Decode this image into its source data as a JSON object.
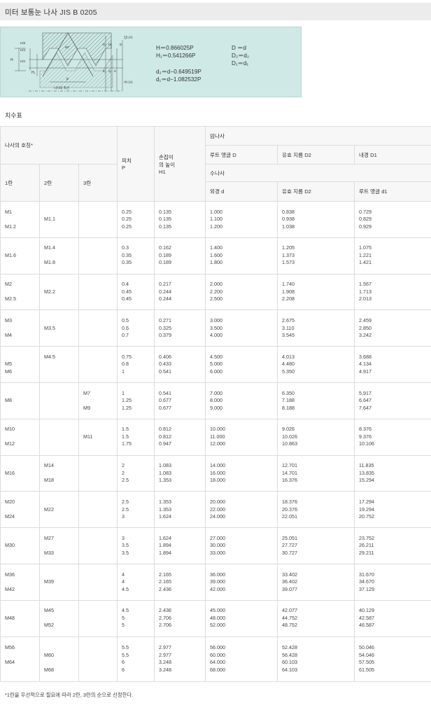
{
  "title": "미터 보통눈 나사 JIS B 0205",
  "diagram": {
    "formulas_left": [
      "H＝0.866025P",
      "H₁＝0.541266P",
      "d₂＝d−0.649519P",
      "d₁＝d−1.082532P"
    ],
    "formulas_right": [
      "D ＝d",
      "D₂＝d₂",
      "D₁＝d₁"
    ],
    "labels": {
      "axis": "나사의 축선",
      "p": "P",
      "nut": "암나사",
      "bolt": "수나사",
      "d": "d",
      "d2": "d₂",
      "d1": "d₁",
      "D": "D",
      "D2": "D₂",
      "D1": "D₁",
      "h1": "H₁",
      "h": "H",
      "h_small": "H/8",
      "h_quarter": "H/4",
      "h_half": "H/2",
      "angle": "60°"
    }
  },
  "section_title": "치수표",
  "table": {
    "header": {
      "designation": "나사의 호칭*",
      "col1": "1란",
      "col2": "2란",
      "col3": "3란",
      "pitch": "피치\nP",
      "height": "손잡이\n의 높이\nH1",
      "nut": "암나사",
      "bolt": "수나사",
      "root_D": "루트 앵글 D",
      "eff_D2": "유효 지름 D2",
      "inner_D1": "내경 D1",
      "outer_d": "외경 d",
      "eff_d2": "유효 지름 D2",
      "root_d1": "루트 앵글 d1"
    },
    "groups": [
      {
        "c1": [
          "M1",
          "",
          "M1.2"
        ],
        "c2": [
          "",
          "M1.1",
          ""
        ],
        "c3": [
          "",
          "",
          ""
        ],
        "p": [
          "0.25",
          "0.25",
          "0.25"
        ],
        "h1": [
          "0.135",
          "0.135",
          "0.135"
        ],
        "d": [
          "1.000",
          "1.100",
          "1.200"
        ],
        "d2": [
          "0.838",
          "0.938",
          "1.038"
        ],
        "d1": [
          "0.729",
          "0.829",
          "0.929"
        ]
      },
      {
        "c1": [
          "",
          "M1.6",
          ""
        ],
        "c2": [
          "M1.4",
          "",
          "M1.8"
        ],
        "c3": [
          "",
          "",
          ""
        ],
        "p": [
          "0.3",
          "0.35",
          "0.35"
        ],
        "h1": [
          "0.162",
          "0.189",
          "0.189"
        ],
        "d": [
          "1.400",
          "1.600",
          "1.800"
        ],
        "d2": [
          "1.205",
          "1.373",
          "1.573"
        ],
        "d1": [
          "1.075",
          "1.221",
          "1.421"
        ]
      },
      {
        "c1": [
          "M2",
          "",
          "M2.5"
        ],
        "c2": [
          "",
          "M2.2",
          ""
        ],
        "c3": [
          "",
          "",
          ""
        ],
        "p": [
          "0.4",
          "0.45",
          "0.45"
        ],
        "h1": [
          "0.217",
          "0.244",
          "0.244"
        ],
        "d": [
          "2.000",
          "2.200",
          "2.500"
        ],
        "d2": [
          "1.740",
          "1.908",
          "2.208"
        ],
        "d1": [
          "1.567",
          "1.713",
          "2.013"
        ]
      },
      {
        "c1": [
          "M3",
          "",
          "M4"
        ],
        "c2": [
          "",
          "M3.5",
          ""
        ],
        "c3": [
          "",
          "",
          ""
        ],
        "p": [
          "0.5",
          "0.6",
          "0.7"
        ],
        "h1": [
          "0.271",
          "0.325",
          "0.379"
        ],
        "d": [
          "3.000",
          "3.500",
          "4.000"
        ],
        "d2": [
          "2.675",
          "3.110",
          "3.545"
        ],
        "d1": [
          "2.459",
          "2.850",
          "3.242"
        ]
      },
      {
        "c1": [
          "",
          "M5",
          "M6"
        ],
        "c2": [
          "M4.5",
          "",
          ""
        ],
        "c3": [
          "",
          "",
          ""
        ],
        "p": [
          "0.75",
          "0.8",
          "1"
        ],
        "h1": [
          "0.406",
          "0.433",
          "0.541"
        ],
        "d": [
          "4.500",
          "5.000",
          "6.000"
        ],
        "d2": [
          "4.013",
          "4.480",
          "5.350"
        ],
        "d1": [
          "3.688",
          "4.134",
          "4.917"
        ]
      },
      {
        "c1": [
          "",
          "M8",
          ""
        ],
        "c2": [
          "",
          "",
          ""
        ],
        "c3": [
          "M7",
          "",
          "M9"
        ],
        "p": [
          "1",
          "1.25",
          "1.25"
        ],
        "h1": [
          "0.541",
          "0.677",
          "0.677"
        ],
        "d": [
          "7.000",
          "8.000",
          "9.000"
        ],
        "d2": [
          "6.350",
          "7.188",
          "8.188"
        ],
        "d1": [
          "5.917",
          "6.647",
          "7.647"
        ]
      },
      {
        "c1": [
          "M10",
          "",
          "M12"
        ],
        "c2": [
          "",
          "",
          ""
        ],
        "c3": [
          "",
          "M11",
          ""
        ],
        "p": [
          "1.5",
          "1.5",
          "1.75"
        ],
        "h1": [
          "0.812",
          "0.812",
          "0.947"
        ],
        "d": [
          "10.000",
          "11.000",
          "12.000"
        ],
        "d2": [
          "9.026",
          "10.026",
          "10.863"
        ],
        "d1": [
          "8.376",
          "9.376",
          "10.106"
        ]
      },
      {
        "c1": [
          "",
          "M16",
          ""
        ],
        "c2": [
          "M14",
          "",
          "M18"
        ],
        "c3": [
          "",
          "",
          ""
        ],
        "p": [
          "2",
          "2",
          "2.5"
        ],
        "h1": [
          "1.083",
          "1.083",
          "1.353"
        ],
        "d": [
          "14.000",
          "16.000",
          "18.000"
        ],
        "d2": [
          "12.701",
          "14.701",
          "16.376"
        ],
        "d1": [
          "11.835",
          "13.835",
          "15.294"
        ]
      },
      {
        "c1": [
          "M20",
          "",
          "M24"
        ],
        "c2": [
          "",
          "M22",
          ""
        ],
        "c3": [
          "",
          "",
          ""
        ],
        "p": [
          "2.5",
          "2.5",
          "3"
        ],
        "h1": [
          "1.353",
          "1.353",
          "1.624"
        ],
        "d": [
          "20.000",
          "22.000",
          "24.000"
        ],
        "d2": [
          "18.376",
          "20.376",
          "22.051"
        ],
        "d1": [
          "17.294",
          "19.294",
          "20.752"
        ]
      },
      {
        "c1": [
          "",
          "M30",
          ""
        ],
        "c2": [
          "M27",
          "",
          "M33"
        ],
        "c3": [
          "",
          "",
          ""
        ],
        "p": [
          "3",
          "3.5",
          "3.5"
        ],
        "h1": [
          "1.624",
          "1.894",
          "1.894"
        ],
        "d": [
          "27.000",
          "30.000",
          "33.000"
        ],
        "d2": [
          "25.051",
          "27.727",
          "30.727"
        ],
        "d1": [
          "23.752",
          "26.211",
          "29.211"
        ]
      },
      {
        "c1": [
          "M36",
          "",
          "M42"
        ],
        "c2": [
          "",
          "M39",
          ""
        ],
        "c3": [
          "",
          "",
          ""
        ],
        "p": [
          "4",
          "4",
          "4.5"
        ],
        "h1": [
          "2.165",
          "2.165",
          "2.436"
        ],
        "d": [
          "36.000",
          "39.000",
          "42.000"
        ],
        "d2": [
          "33.402",
          "36.402",
          "39.077"
        ],
        "d1": [
          "31.670",
          "34.670",
          "37.129"
        ]
      },
      {
        "c1": [
          "",
          "M48",
          ""
        ],
        "c2": [
          "M45",
          "",
          "M52"
        ],
        "c3": [
          "",
          "",
          ""
        ],
        "p": [
          "4.5",
          "5",
          "5"
        ],
        "h1": [
          "2.436",
          "2.706",
          "2.706"
        ],
        "d": [
          "45.000",
          "48.000",
          "52.000"
        ],
        "d2": [
          "42.077",
          "44.752",
          "48.752"
        ],
        "d1": [
          "40.129",
          "42.587",
          "46.587"
        ]
      },
      {
        "c1": [
          "M56",
          "",
          "M64",
          ""
        ],
        "c2": [
          "",
          "M60",
          "",
          "M68"
        ],
        "c3": [
          "",
          "",
          "",
          ""
        ],
        "p": [
          "5.5",
          "5.5",
          "6",
          "6"
        ],
        "h1": [
          "2.977",
          "2.977",
          "3.248",
          "3.248"
        ],
        "d": [
          "56.000",
          "60.000",
          "64.000",
          "68.000"
        ],
        "d2": [
          "52.428",
          "56.428",
          "60.103",
          "64.103"
        ],
        "d1": [
          "50.046",
          "54.046",
          "57.505",
          "61.505"
        ]
      }
    ]
  },
  "footnote": "*1란을 우선적으로 필요에 따라 2란, 3란의 순으로 선정한다."
}
